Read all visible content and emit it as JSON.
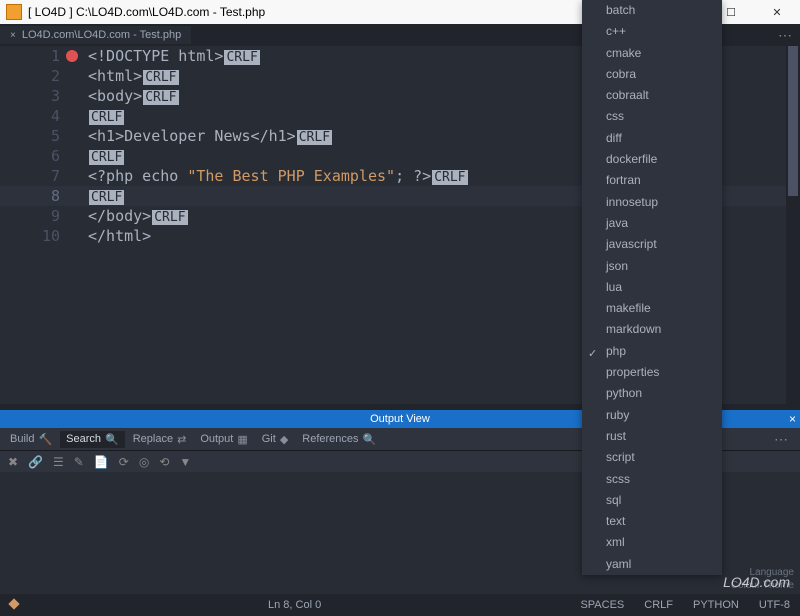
{
  "window": {
    "title": "[ LO4D ] C:\\LO4D.com\\LO4D.com - Test.php",
    "min": "—",
    "max": "☐",
    "close": "✕"
  },
  "tab": {
    "label": "LO4D.com\\LO4D.com - Test.php",
    "close": "×"
  },
  "lines": [
    {
      "n": "1",
      "type": "html",
      "pre": "<!DOCTYPE html>",
      "crlf": "CRLF",
      "bp": true
    },
    {
      "n": "2",
      "type": "html",
      "pre": "<html>",
      "crlf": "CRLF"
    },
    {
      "n": "3",
      "type": "html",
      "pre": "<body>",
      "crlf": "CRLF"
    },
    {
      "n": "4",
      "type": "blank",
      "crlf": "CRLF"
    },
    {
      "n": "5",
      "type": "html",
      "pre": "<h1>Developer News</h1>",
      "crlf": "CRLF"
    },
    {
      "n": "6",
      "type": "blank",
      "crlf": "CRLF"
    },
    {
      "n": "7",
      "type": "php",
      "pre": "<?php echo ",
      "str": "\"The Best PHP Examples\"",
      "post": "; ?>",
      "crlf": "CRLF"
    },
    {
      "n": "8",
      "type": "blank",
      "crlf": "CRLF",
      "active": true
    },
    {
      "n": "9",
      "type": "html",
      "pre": "</body>",
      "crlf": "CRLF"
    },
    {
      "n": "10",
      "type": "html",
      "pre": "</html>"
    }
  ],
  "output_header": "Output View",
  "output_close": "×",
  "panel_tabs": [
    {
      "label": "Build",
      "icon": "🔨"
    },
    {
      "label": "Search",
      "icon": "🔍",
      "active": true
    },
    {
      "label": "Replace",
      "icon": "⇄"
    },
    {
      "label": "Output",
      "icon": "▦"
    },
    {
      "label": "Git",
      "icon": "◆"
    },
    {
      "label": "References",
      "icon": "🔍"
    }
  ],
  "toolbar_icons": [
    "✖",
    "🔗",
    "☰",
    "✎",
    "📄",
    "⟳",
    "◎",
    "⟲",
    "▼"
  ],
  "status": {
    "cursor": "Ln 8, Col 0",
    "indent": "SPACES",
    "eol": "CRLF",
    "lang": "PYTHON",
    "enc": "UTF-8"
  },
  "lang_meta": {
    "line1": "Language",
    "line2": "Colour Theme"
  },
  "languages": [
    "batch",
    "c++",
    "cmake",
    "cobra",
    "cobraalt",
    "css",
    "diff",
    "dockerfile",
    "fortran",
    "innosetup",
    "java",
    "javascript",
    "json",
    "lua",
    "makefile",
    "markdown",
    "php",
    "properties",
    "python",
    "ruby",
    "rust",
    "script",
    "scss",
    "sql",
    "text",
    "xml",
    "yaml"
  ],
  "language_selected": "php",
  "watermark": "LO4D.com"
}
